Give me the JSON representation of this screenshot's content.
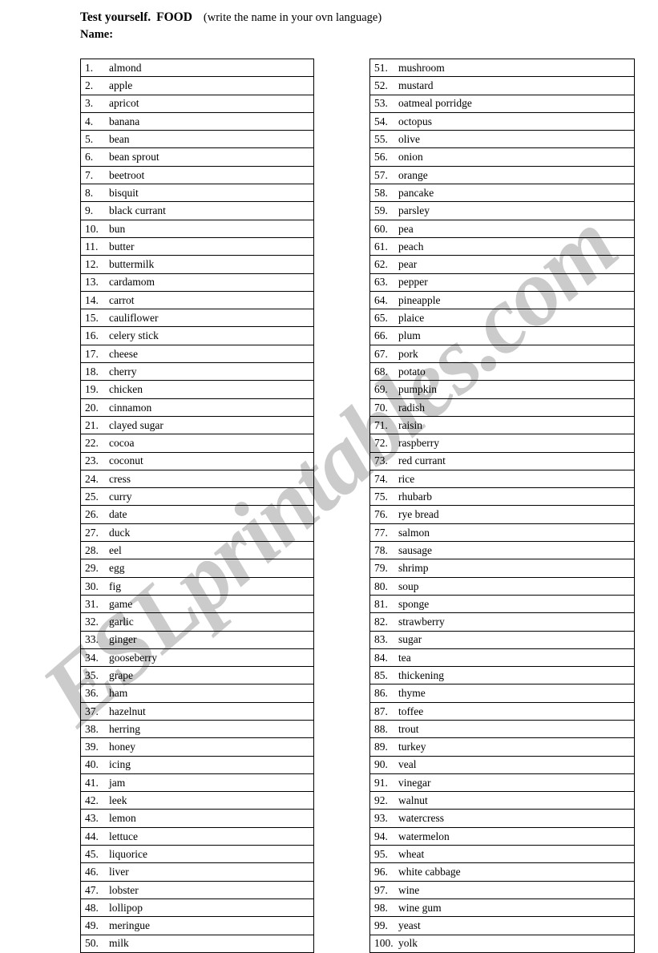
{
  "header": {
    "title_main": "Test yourself.",
    "title_topic": "FOOD",
    "title_note": "(write the name in your ovn language)",
    "name_label": "Name:"
  },
  "watermark": {
    "text": "ESLprintables.com",
    "color": "#c9c9c9"
  },
  "columns": {
    "left": [
      {
        "num": "1.",
        "label": "almond"
      },
      {
        "num": "2.",
        "label": "apple"
      },
      {
        "num": "3.",
        "label": "apricot"
      },
      {
        "num": "4.",
        "label": "banana"
      },
      {
        "num": "5.",
        "label": "bean"
      },
      {
        "num": "6.",
        "label": "bean sprout"
      },
      {
        "num": "7.",
        "label": "beetroot"
      },
      {
        "num": "8.",
        "label": "bisquit"
      },
      {
        "num": "9.",
        "label": "black currant"
      },
      {
        "num": "10.",
        "label": "bun"
      },
      {
        "num": "11.",
        "label": "butter"
      },
      {
        "num": "12.",
        "label": "buttermilk"
      },
      {
        "num": "13.",
        "label": "cardamom"
      },
      {
        "num": "14.",
        "label": "carrot"
      },
      {
        "num": "15.",
        "label": "cauliflower"
      },
      {
        "num": "16.",
        "label": "celery stick"
      },
      {
        "num": "17.",
        "label": "cheese"
      },
      {
        "num": "18.",
        "label": "cherry"
      },
      {
        "num": "19.",
        "label": "chicken"
      },
      {
        "num": "20.",
        "label": "cinnamon"
      },
      {
        "num": "21.",
        "label": "clayed sugar"
      },
      {
        "num": "22.",
        "label": "cocoa"
      },
      {
        "num": "23.",
        "label": "coconut"
      },
      {
        "num": "24.",
        "label": "cress"
      },
      {
        "num": "25.",
        "label": "curry"
      },
      {
        "num": "26.",
        "label": "date"
      },
      {
        "num": "27.",
        "label": "duck"
      },
      {
        "num": "28.",
        "label": "eel"
      },
      {
        "num": "29.",
        "label": "egg"
      },
      {
        "num": "30.",
        "label": "fig"
      },
      {
        "num": "31.",
        "label": "game"
      },
      {
        "num": "32.",
        "label": "garlic"
      },
      {
        "num": "33.",
        "label": "ginger"
      },
      {
        "num": "34.",
        "label": "gooseberry"
      },
      {
        "num": "35.",
        "label": "grape"
      },
      {
        "num": "36.",
        "label": "ham"
      },
      {
        "num": "37.",
        "label": "hazelnut"
      },
      {
        "num": "38.",
        "label": "herring"
      },
      {
        "num": "39.",
        "label": "honey"
      },
      {
        "num": "40.",
        "label": "icing"
      },
      {
        "num": "41.",
        "label": "jam"
      },
      {
        "num": "42.",
        "label": "leek"
      },
      {
        "num": "43.",
        "label": "lemon"
      },
      {
        "num": "44.",
        "label": "lettuce"
      },
      {
        "num": "45.",
        "label": "liquorice"
      },
      {
        "num": "46.",
        "label": "liver"
      },
      {
        "num": "47.",
        "label": "lobster"
      },
      {
        "num": "48.",
        "label": "lollipop"
      },
      {
        "num": "49.",
        "label": "meringue"
      },
      {
        "num": "50.",
        "label": "milk"
      }
    ],
    "right": [
      {
        "num": "51.",
        "label": "mushroom"
      },
      {
        "num": "52.",
        "label": "mustard"
      },
      {
        "num": "53.",
        "label": "oatmeal porridge"
      },
      {
        "num": "54.",
        "label": "octopus"
      },
      {
        "num": "55.",
        "label": "olive"
      },
      {
        "num": "56.",
        "label": "onion"
      },
      {
        "num": "57.",
        "label": "orange"
      },
      {
        "num": "58.",
        "label": "pancake"
      },
      {
        "num": "59.",
        "label": "parsley"
      },
      {
        "num": "60.",
        "label": "pea"
      },
      {
        "num": "61.",
        "label": "peach"
      },
      {
        "num": "62.",
        "label": "pear"
      },
      {
        "num": "63.",
        "label": "pepper"
      },
      {
        "num": "64.",
        "label": "pineapple"
      },
      {
        "num": "65.",
        "label": "plaice"
      },
      {
        "num": "66.",
        "label": "plum"
      },
      {
        "num": "67.",
        "label": "pork"
      },
      {
        "num": "68.",
        "label": "potato"
      },
      {
        "num": "69.",
        "label": "pumpkin"
      },
      {
        "num": "70.",
        "label": "radish"
      },
      {
        "num": "71.",
        "label": "raisin"
      },
      {
        "num": "72.",
        "label": "raspberry"
      },
      {
        "num": "73.",
        "label": "red currant"
      },
      {
        "num": "74.",
        "label": "rice"
      },
      {
        "num": "75.",
        "label": "rhubarb"
      },
      {
        "num": "76.",
        "label": "rye bread"
      },
      {
        "num": "77.",
        "label": "salmon"
      },
      {
        "num": "78.",
        "label": "sausage"
      },
      {
        "num": "79.",
        "label": "shrimp"
      },
      {
        "num": "80.",
        "label": "soup"
      },
      {
        "num": "81.",
        "label": "sponge"
      },
      {
        "num": "82.",
        "label": "strawberry"
      },
      {
        "num": "83.",
        "label": "sugar"
      },
      {
        "num": "84.",
        "label": "tea"
      },
      {
        "num": "85.",
        "label": "thickening"
      },
      {
        "num": "86.",
        "label": "thyme"
      },
      {
        "num": "87.",
        "label": "toffee"
      },
      {
        "num": "88.",
        "label": "trout"
      },
      {
        "num": "89.",
        "label": "turkey"
      },
      {
        "num": "90.",
        "label": "veal"
      },
      {
        "num": "91.",
        "label": "vinegar"
      },
      {
        "num": "92.",
        "label": "walnut"
      },
      {
        "num": "93.",
        "label": "watercress"
      },
      {
        "num": "94.",
        "label": "watermelon"
      },
      {
        "num": "95.",
        "label": "wheat"
      },
      {
        "num": "96.",
        "label": "white cabbage"
      },
      {
        "num": "97.",
        "label": "wine"
      },
      {
        "num": "98.",
        "label": "wine gum"
      },
      {
        "num": "99.",
        "label": "yeast"
      },
      {
        "num": "100.",
        "label": "yolk"
      }
    ]
  }
}
